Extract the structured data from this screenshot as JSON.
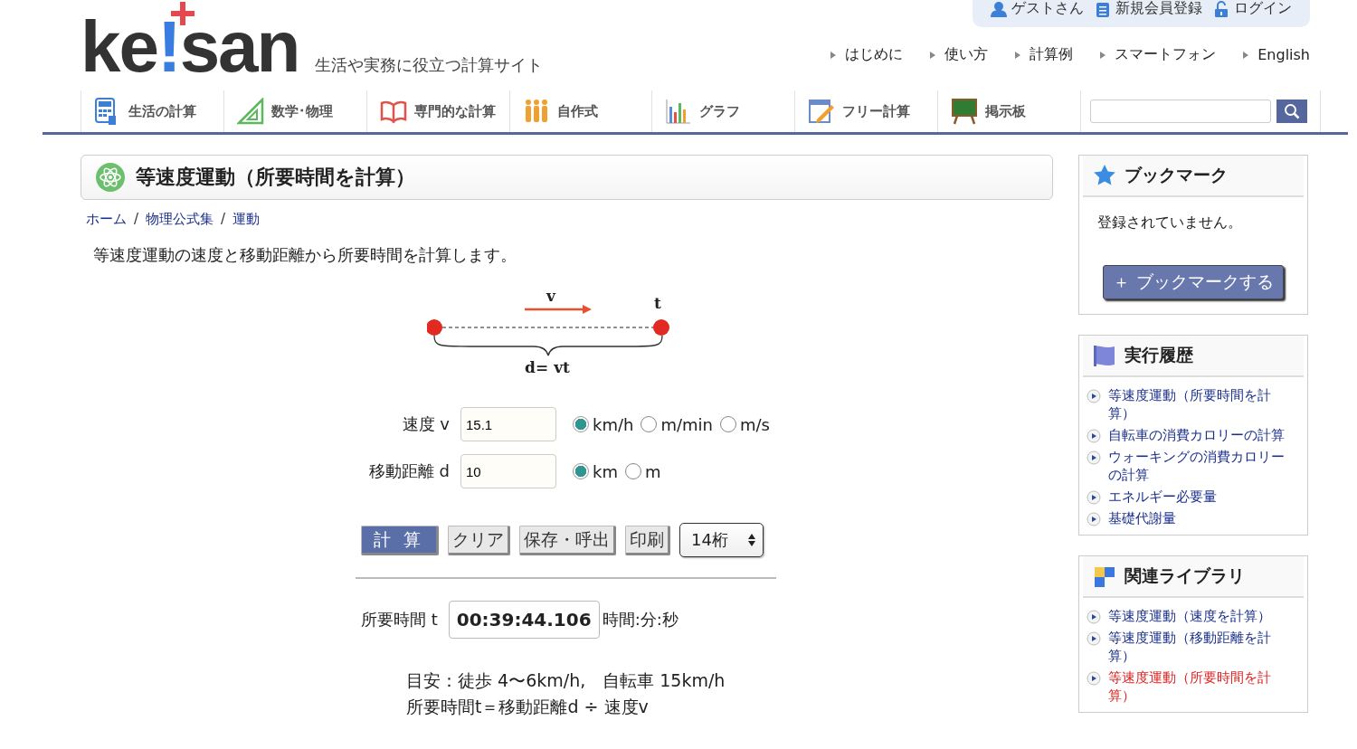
{
  "user_bar": {
    "items": [
      "ゲストさん",
      "新規会員登録",
      "ログイン"
    ]
  },
  "logo": {
    "parts": [
      {
        "text": "ke",
        "accent": false
      },
      {
        "text": "!",
        "accent": true
      },
      {
        "text": "san",
        "accent": false
      }
    ],
    "tagline": "生活や実務に役立つ計算サイト"
  },
  "top_links": [
    "はじめに",
    "使い方",
    "計算例",
    "スマートフォン",
    "English"
  ],
  "nav": [
    {
      "label": "生活の計算"
    },
    {
      "label": "数学･物理"
    },
    {
      "label": "専門的な計算"
    },
    {
      "label": "自作式"
    },
    {
      "label": "グラフ"
    },
    {
      "label": "フリー計算"
    },
    {
      "label": "掲示板"
    }
  ],
  "page_title": "等速度運動（所要時間を計算）",
  "breadcrumb": [
    {
      "text": "ホーム",
      "kind": "link"
    },
    {
      "text": "/",
      "kind": "separator"
    },
    {
      "text": "物理公式集",
      "kind": "link"
    },
    {
      "text": "/",
      "kind": "separator"
    },
    {
      "text": "運動",
      "kind": "link"
    }
  ],
  "description": "等速度運動の速度と移動距離から所要時間を計算します。",
  "diagram": {
    "speed_label": "v",
    "time_label": "t",
    "formula": "d= vt"
  },
  "inputs": [
    {
      "label": "速度 v",
      "value": "15.1",
      "units": [
        {
          "label": "km/h",
          "selected": true
        },
        {
          "label": "m/min",
          "selected": false
        },
        {
          "label": "m/s",
          "selected": false
        }
      ]
    },
    {
      "label": "移動距離 d",
      "value": "10",
      "units": [
        {
          "label": "km",
          "selected": true
        },
        {
          "label": "m",
          "selected": false
        }
      ]
    }
  ],
  "buttons": [
    {
      "label": "計 算",
      "kind": "primary"
    },
    {
      "label": "クリア",
      "kind": "normal"
    },
    {
      "label": "保存・呼出",
      "kind": "normal"
    },
    {
      "label": "印刷",
      "kind": "normal"
    }
  ],
  "digits": "14桁",
  "result": {
    "label": "所要時間 t",
    "value": "00:39:44.106",
    "unit": "時間:分:秒"
  },
  "notes": [
    "目安：徒歩 4〜6km/h,　自転車 15km/h",
    "所要時間t＝移動距離d ÷ 速度v"
  ],
  "bookmark": {
    "title": "ブックマーク",
    "empty_text": "登録されていません。",
    "button": "＋ ブックマークする"
  },
  "history": {
    "title": "実行履歴",
    "items": [
      "等速度運動（所要時間を計算）",
      "自転車の消費カロリーの計算",
      "ウォーキングの消費カロリーの計算",
      "エネルギー必要量",
      "基礎代謝量"
    ]
  },
  "related": {
    "title": "関連ライブラリ",
    "items": [
      {
        "label": "等速度運動（速度を計算）",
        "selected": false
      },
      {
        "label": "等速度運動（移動距離を計算）",
        "selected": false
      },
      {
        "label": "等速度運動（所要時間を計算）",
        "selected": true
      }
    ]
  }
}
